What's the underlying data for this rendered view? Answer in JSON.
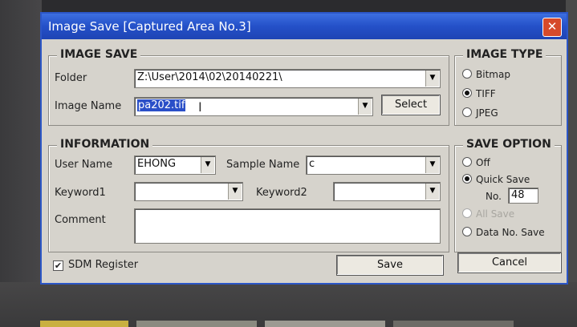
{
  "window": {
    "title": "Image Save [Captured Area No.3]",
    "close_icon": "close-icon"
  },
  "image_save": {
    "title": "IMAGE SAVE",
    "folder_label": "Folder",
    "folder_value": "Z:\\User\\2014\\02\\20140221\\",
    "image_name_label": "Image Name",
    "image_name_value": "pa202.tif",
    "select_label": "Select"
  },
  "information": {
    "title": "INFORMATION",
    "user_name_label": "User Name",
    "user_name_value": "EHONG",
    "sample_name_label": "Sample Name",
    "sample_name_value": "c",
    "keyword1_label": "Keyword1",
    "keyword1_value": "",
    "keyword2_label": "Keyword2",
    "keyword2_value": "",
    "comment_label": "Comment",
    "comment_value": ""
  },
  "image_type": {
    "title": "IMAGE TYPE",
    "options": [
      "Bitmap",
      "TIFF",
      "JPEG"
    ],
    "selected": "TIFF"
  },
  "save_option": {
    "title": "SAVE OPTION",
    "off_label": "Off",
    "quick_save_label": "Quick Save",
    "no_label": "No.",
    "no_value": "48",
    "all_save_label": "All Save",
    "data_no_save_label": "Data No. Save",
    "selected": "Quick Save"
  },
  "footer": {
    "sdm_register_label": "SDM Register",
    "sdm_register_checked": true,
    "checkmark": "✔",
    "save_label": "Save",
    "cancel_label": "Cancel"
  }
}
